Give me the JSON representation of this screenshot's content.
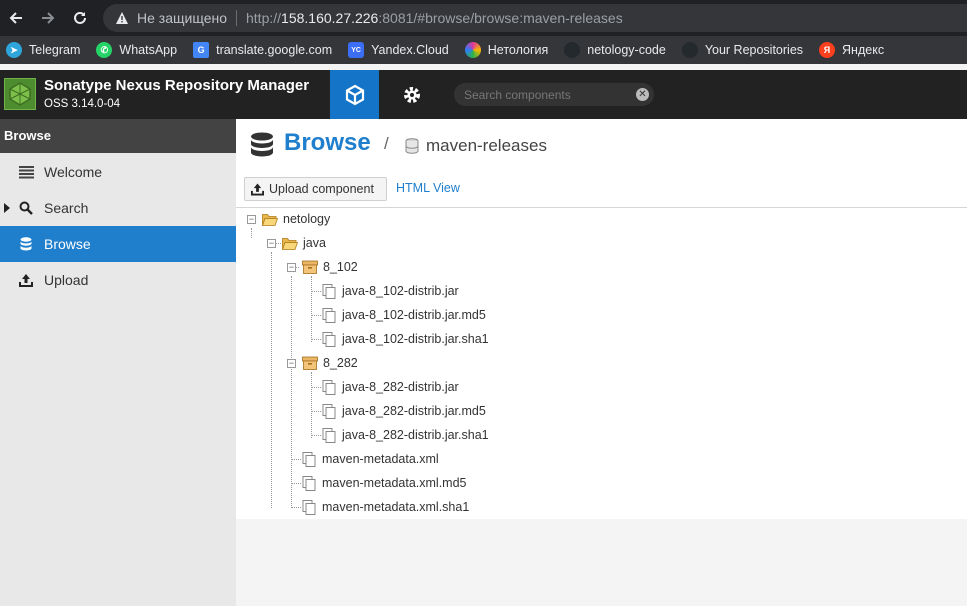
{
  "browser": {
    "insecure_label": "Не защищено",
    "url_prefix": "http://",
    "url_host": "158.160.27.226",
    "url_rest": ":8081/#browse/browse:maven-releases",
    "bookmarks": [
      {
        "label": "Telegram",
        "icon": "telegram-icon",
        "color": "#2ea6db"
      },
      {
        "label": "WhatsApp",
        "icon": "whatsapp-icon",
        "color": "#25d366"
      },
      {
        "label": "translate.google.com",
        "icon": "google-translate-icon",
        "color": "#4285f4"
      },
      {
        "label": "Yandex.Cloud",
        "icon": "yandex-cloud-icon",
        "color": "#3b6ef5"
      },
      {
        "label": "Нетология",
        "icon": "netology-icon",
        "color": "#e0359a"
      },
      {
        "label": "netology-code",
        "icon": "github-icon",
        "color": "#24292e"
      },
      {
        "label": "Your Repositories",
        "icon": "github-icon",
        "color": "#24292e"
      },
      {
        "label": "Яндекс",
        "icon": "yandex-icon",
        "color": "#fc3f1d"
      }
    ]
  },
  "app": {
    "title": "Sonatype Nexus Repository Manager",
    "version": "OSS 3.14.0-04",
    "search_placeholder": "Search components",
    "accent": "#1f7fcd"
  },
  "sidebar": {
    "header": "Browse",
    "items": [
      {
        "label": "Welcome",
        "icon": "list-icon"
      },
      {
        "label": "Search",
        "icon": "search-icon"
      },
      {
        "label": "Browse",
        "icon": "database-icon",
        "active": true
      },
      {
        "label": "Upload",
        "icon": "upload-icon"
      }
    ]
  },
  "main": {
    "title": "Browse",
    "separator": "/",
    "repository": "maven-releases",
    "upload_button": "Upload component",
    "html_view_link": "HTML View"
  },
  "tree": [
    {
      "label": "netology",
      "type": "folder"
    },
    {
      "label": "java",
      "type": "folder"
    },
    {
      "label": "8_102",
      "type": "component"
    },
    {
      "label": "java-8_102-distrib.jar",
      "type": "file"
    },
    {
      "label": "java-8_102-distrib.jar.md5",
      "type": "file"
    },
    {
      "label": "java-8_102-distrib.jar.sha1",
      "type": "file"
    },
    {
      "label": "8_282",
      "type": "component"
    },
    {
      "label": "java-8_282-distrib.jar",
      "type": "file"
    },
    {
      "label": "java-8_282-distrib.jar.md5",
      "type": "file"
    },
    {
      "label": "java-8_282-distrib.jar.sha1",
      "type": "file"
    },
    {
      "label": "maven-metadata.xml",
      "type": "file"
    },
    {
      "label": "maven-metadata.xml.md5",
      "type": "file"
    },
    {
      "label": "maven-metadata.xml.sha1",
      "type": "file"
    }
  ]
}
